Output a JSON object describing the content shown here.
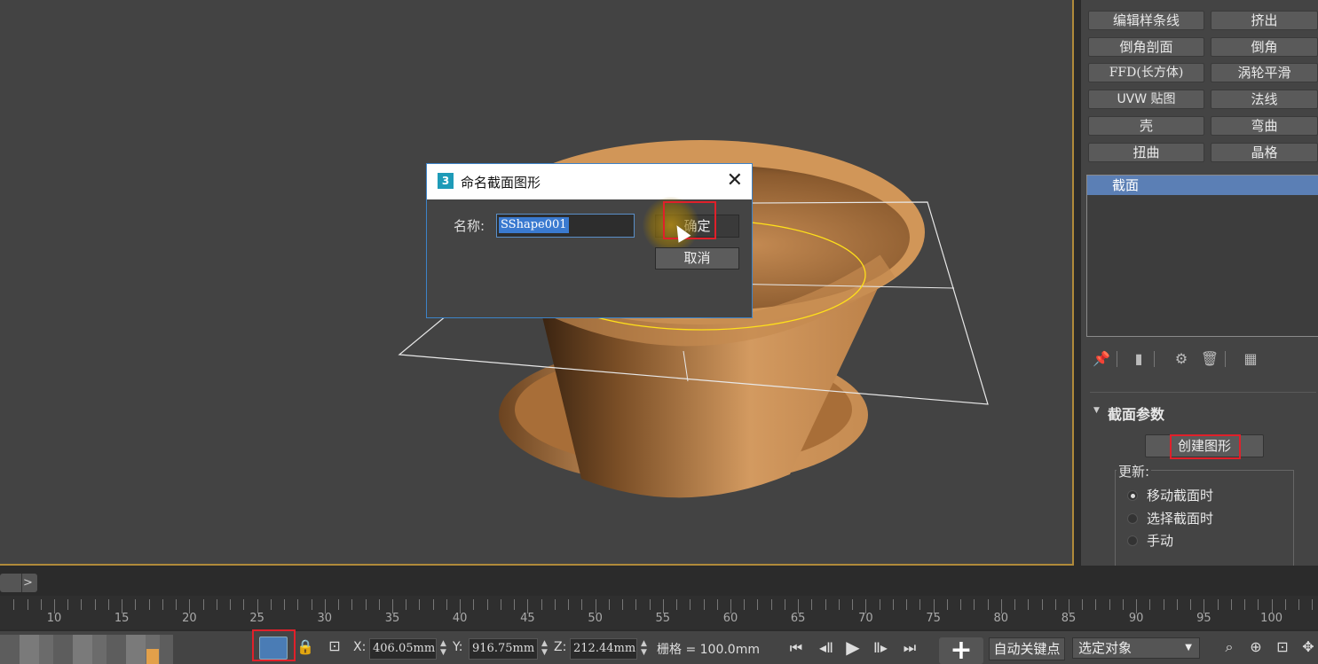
{
  "dialog": {
    "app_icon": "3",
    "title": "命名截面图形",
    "close_icon": "close-icon",
    "name_label": "名称:",
    "name_value": "SShape001",
    "ok_label": "确定",
    "cancel_label": "取消"
  },
  "modifier_buttons": [
    "编辑样条线",
    "挤出",
    "倒角剖面",
    "倒角",
    "FFD(长方体)",
    "涡轮平滑",
    "UVW 贴图",
    "法线",
    "壳",
    "弯曲",
    "扭曲",
    "晶格"
  ],
  "modifier_stack": {
    "items": [
      "截面"
    ]
  },
  "stack_tools": [
    "pin-icon",
    "show-end-result-icon",
    "make-unique-icon",
    "remove-modifier-icon",
    "configure-icon"
  ],
  "section_params": {
    "title": "截面参数",
    "create_shape_label": "创建图形",
    "update_label": "更新:",
    "options": [
      {
        "label": "移动截面时",
        "selected": true
      },
      {
        "label": "选择截面时",
        "selected": false
      },
      {
        "label": "手动",
        "selected": false
      }
    ]
  },
  "timeline": {
    "scroll_icon": "chevron-right-icon",
    "ticks": [
      "10",
      "15",
      "20",
      "25",
      "30",
      "35",
      "40",
      "45",
      "50",
      "55",
      "60",
      "65",
      "70",
      "75",
      "80",
      "85",
      "90",
      "95",
      "100"
    ]
  },
  "statusbar": {
    "x_label": "X:",
    "x_value": "406.05mm",
    "y_label": "Y:",
    "y_value": "916.75mm",
    "z_label": "Z:",
    "z_value": "212.44mm",
    "grid_text": "栅格 = 100.0mm",
    "auto_key_label": "自动关键点",
    "selected_object_label": "选定对象",
    "icons": [
      "selection-region-icon",
      "lock-icon",
      "absolute-mode-icon",
      "go-to-start-icon",
      "previous-frame-icon",
      "play-icon",
      "next-frame-icon",
      "go-to-end-icon",
      "add-key-icon",
      "zoom-icon",
      "zoom-all-icon",
      "zoom-extents-icon",
      "pan-icon"
    ]
  },
  "colors": {
    "viewport_bg": "#434343",
    "object": "#d2975c",
    "highlight_box": "#e0202a",
    "active_border": "#b08a3a",
    "stack_selected": "#5b7fb5"
  }
}
